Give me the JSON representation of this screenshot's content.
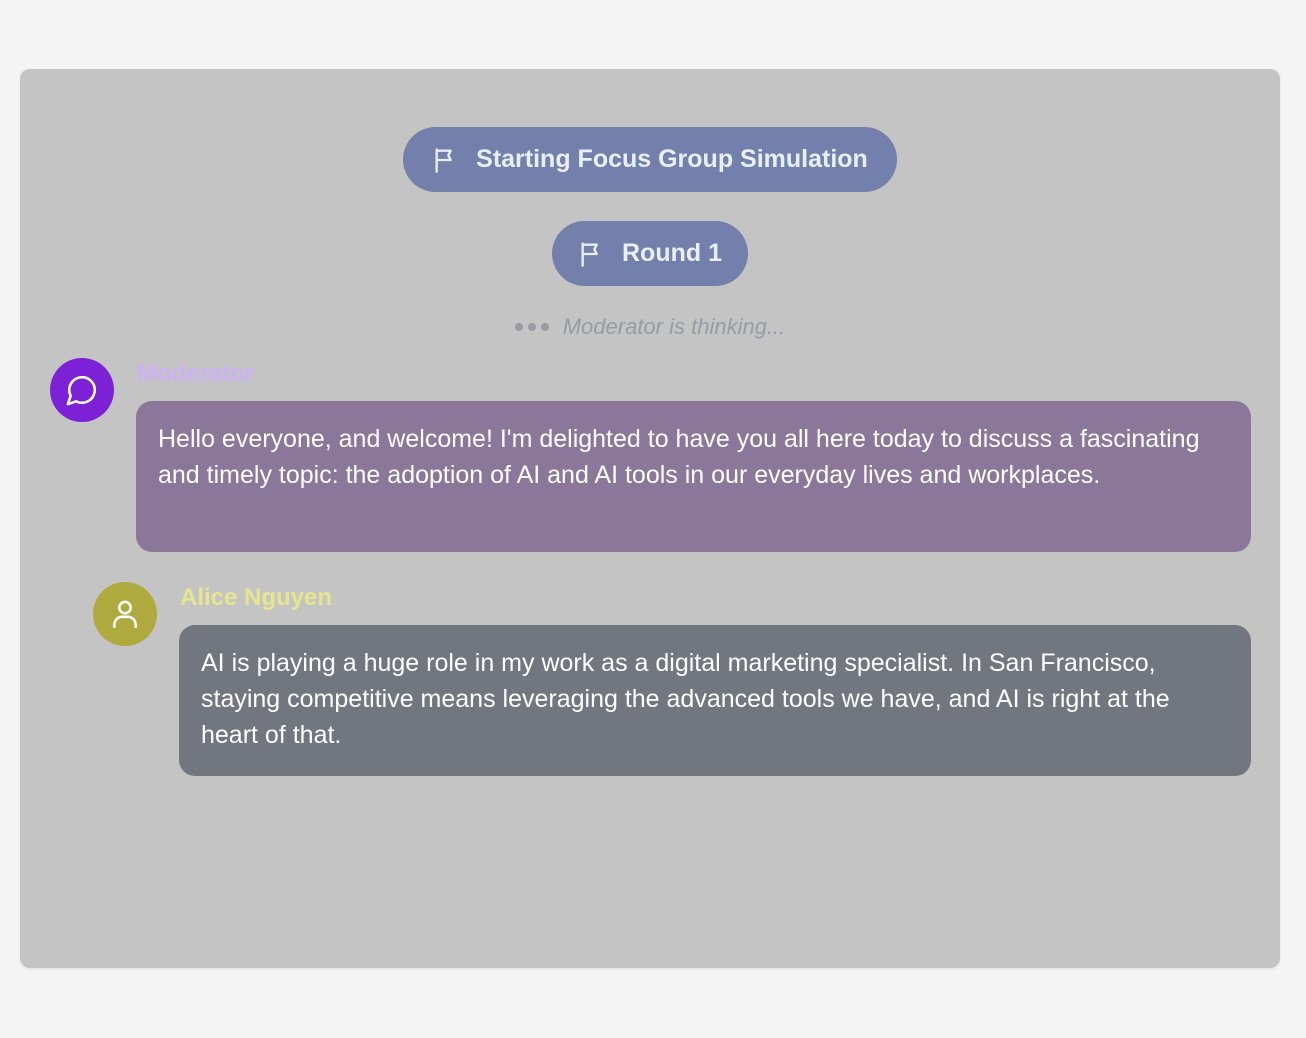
{
  "banners": {
    "start_label": "Starting Focus Group Simulation",
    "round_label": "Round 1"
  },
  "status": {
    "thinking_text": "Moderator is thinking..."
  },
  "messages": [
    {
      "speaker": "Moderator",
      "icon": "chat-bubble-icon",
      "text": "Hello everyone, and welcome! I'm delighted to have you all here today to discuss a fascinating and timely topic: the adoption of AI and AI tools in our everyday lives and workplaces."
    },
    {
      "speaker": "Alice Nguyen",
      "icon": "user-icon",
      "text": "AI is playing a huge role in my work as a digital marketing specialist. In San Francisco, staying competitive means leveraging the advanced tools we have, and AI is right at the heart of that."
    }
  ],
  "colors": {
    "panel_bg": "#c4c4c4",
    "banner_bg": "#7380ab",
    "moderator_avatar": "#7d21d6",
    "moderator_name": "#ccb1f7",
    "moderator_bubble": "#8b7799",
    "alice_avatar": "#aeaa3d",
    "alice_name": "#e6e68e",
    "alice_bubble": "#72767e"
  }
}
